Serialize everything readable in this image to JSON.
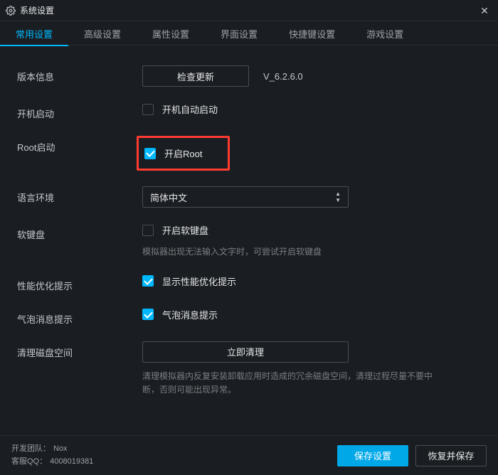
{
  "window": {
    "title": "系统设置"
  },
  "tabs": [
    {
      "label": "常用设置",
      "active": true
    },
    {
      "label": "高级设置",
      "active": false
    },
    {
      "label": "属性设置",
      "active": false
    },
    {
      "label": "界面设置",
      "active": false
    },
    {
      "label": "快捷键设置",
      "active": false
    },
    {
      "label": "游戏设置",
      "active": false
    }
  ],
  "version": {
    "label": "版本信息",
    "checkUpdate": "检查更新",
    "value": "V_6.2.6.0"
  },
  "startup": {
    "label": "开机启动",
    "option": "开机自动启动",
    "checked": false
  },
  "root": {
    "label": "Root启动",
    "option": "开启Root",
    "checked": true
  },
  "language": {
    "label": "语言环境",
    "value": "简体中文"
  },
  "softKeyboard": {
    "label": "软键盘",
    "option": "开启软键盘",
    "checked": false,
    "hint": "模拟器出现无法输入文字时，可尝试开启软键盘"
  },
  "perfHint": {
    "label": "性能优化提示",
    "option": "显示性能优化提示",
    "checked": true
  },
  "bubbleHint": {
    "label": "气泡消息提示",
    "option": "气泡消息提示",
    "checked": true
  },
  "cleanDisk": {
    "label": "清理磁盘空间",
    "button": "立即清理",
    "hint": "清理模拟器内反复安装卸载应用时造成的冗余磁盘空间，清理过程尽量不要中断，否则可能出现异常。"
  },
  "footer": {
    "team_label": "开发团队：",
    "team_value": "Nox",
    "qq_label": "客服QQ：",
    "qq_value": "4008019381",
    "save": "保存设置",
    "restoreSave": "恢复并保存"
  }
}
